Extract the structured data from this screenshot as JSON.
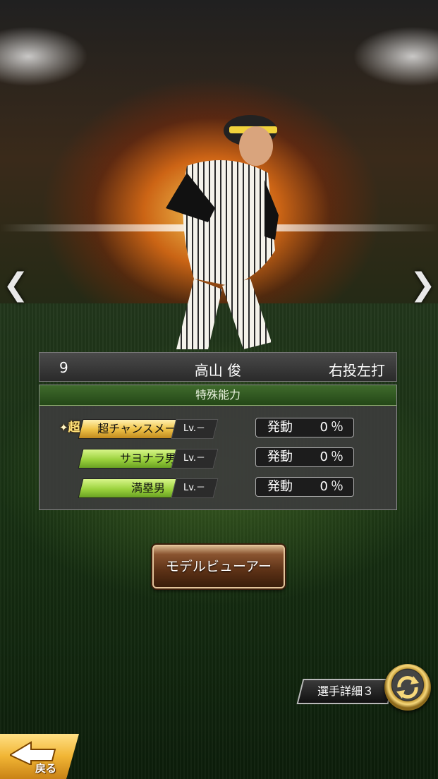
{
  "player": {
    "number": "9",
    "name": "高山 俊",
    "handedness": "右投左打"
  },
  "abilities": {
    "title": "特殊能力",
    "super_mark": "超",
    "items": [
      {
        "name": "超チャンスメーカー",
        "level": "Lv.－",
        "rate_label": "発動",
        "rate_value": "0％",
        "tier": "gold"
      },
      {
        "name": "サヨナラ男",
        "level": "Lv.－",
        "rate_label": "発動",
        "rate_value": "0％",
        "tier": "green"
      },
      {
        "name": "満塁男",
        "level": "Lv.－",
        "rate_label": "発動",
        "rate_value": "0％",
        "tier": "green"
      }
    ]
  },
  "buttons": {
    "model_viewer": "モデルビューアー",
    "detail": "選手詳細３",
    "back": "戻る"
  },
  "nav": {
    "prev": "❮",
    "next": "❯"
  },
  "colors": {
    "gold_tag": "#f0c348",
    "green_tag": "#9bd23d",
    "panel_header": "#3f6b2c",
    "back_button": "#f1b534"
  }
}
